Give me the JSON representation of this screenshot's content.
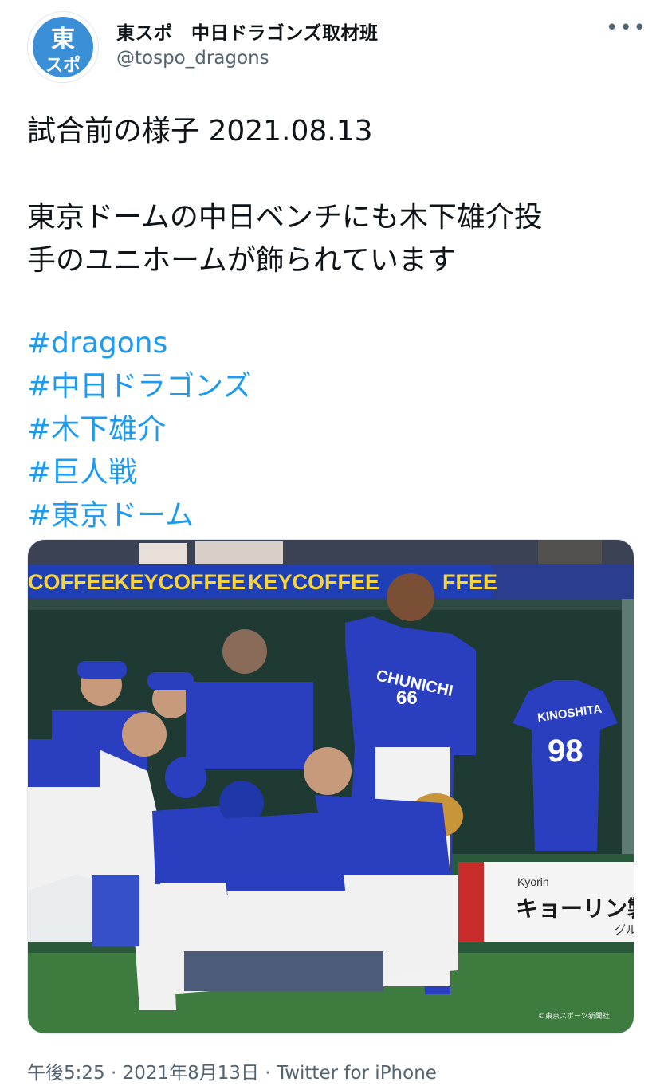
{
  "account": {
    "display_name": "東スポ　中日ドラゴンズ取材班",
    "handle": "@tospo_dragons",
    "avatar_text_top": "東",
    "avatar_text_bottom": "スポ",
    "more_label": "•••"
  },
  "tweet": {
    "lines": [
      "試合前の様子 2021.08.13",
      "",
      "東京ドームの中日ベンチにも木下雄介投",
      "手のユニホームが飾られています"
    ],
    "hashtags": [
      "#dragons",
      "#中日ドラゴンズ",
      "#木下雄介",
      "#巨人戦",
      "#東京ドーム"
    ]
  },
  "photo": {
    "banner_texts": [
      "COFFEE",
      "KEYCOFFEE",
      "KEYCOFFEE",
      "FFEE"
    ],
    "jersey_name": "KINOSHITA",
    "jersey_number": "98",
    "player_number": "66",
    "chest_text": "CHUNICHI",
    "sign_brand": "Kyorin",
    "sign_text": "キョーリン製薬",
    "sign_sub": "グル",
    "credit": "©東京スポーツ新聞社"
  },
  "meta": {
    "time": "午後5:25",
    "date": "2021年8月13日",
    "separator": " · ",
    "source": "Twitter for iPhone"
  },
  "colors": {
    "hashtag": "#1d9bf0",
    "secondary_text": "#536471",
    "dragons_blue": "#2a3fbf"
  }
}
